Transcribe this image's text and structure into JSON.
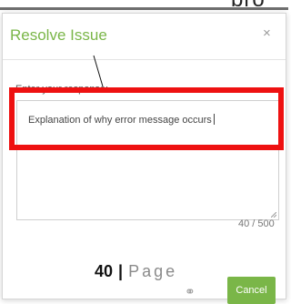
{
  "background_doc": {
    "top_cut_text": "bro",
    "page_number": "40",
    "separator": "|",
    "page_word": "Page"
  },
  "dialog": {
    "title": "Resolve Issue",
    "close_glyph": "×",
    "response_label": "Enter your response:",
    "response_text": "Explanation of why error message occurs",
    "char_count": "40 / 500",
    "link_glyph": "⚭",
    "cancel_label": "Cancel"
  },
  "colors": {
    "accent_green": "#7ab648",
    "highlight_red": "#ee1111"
  }
}
